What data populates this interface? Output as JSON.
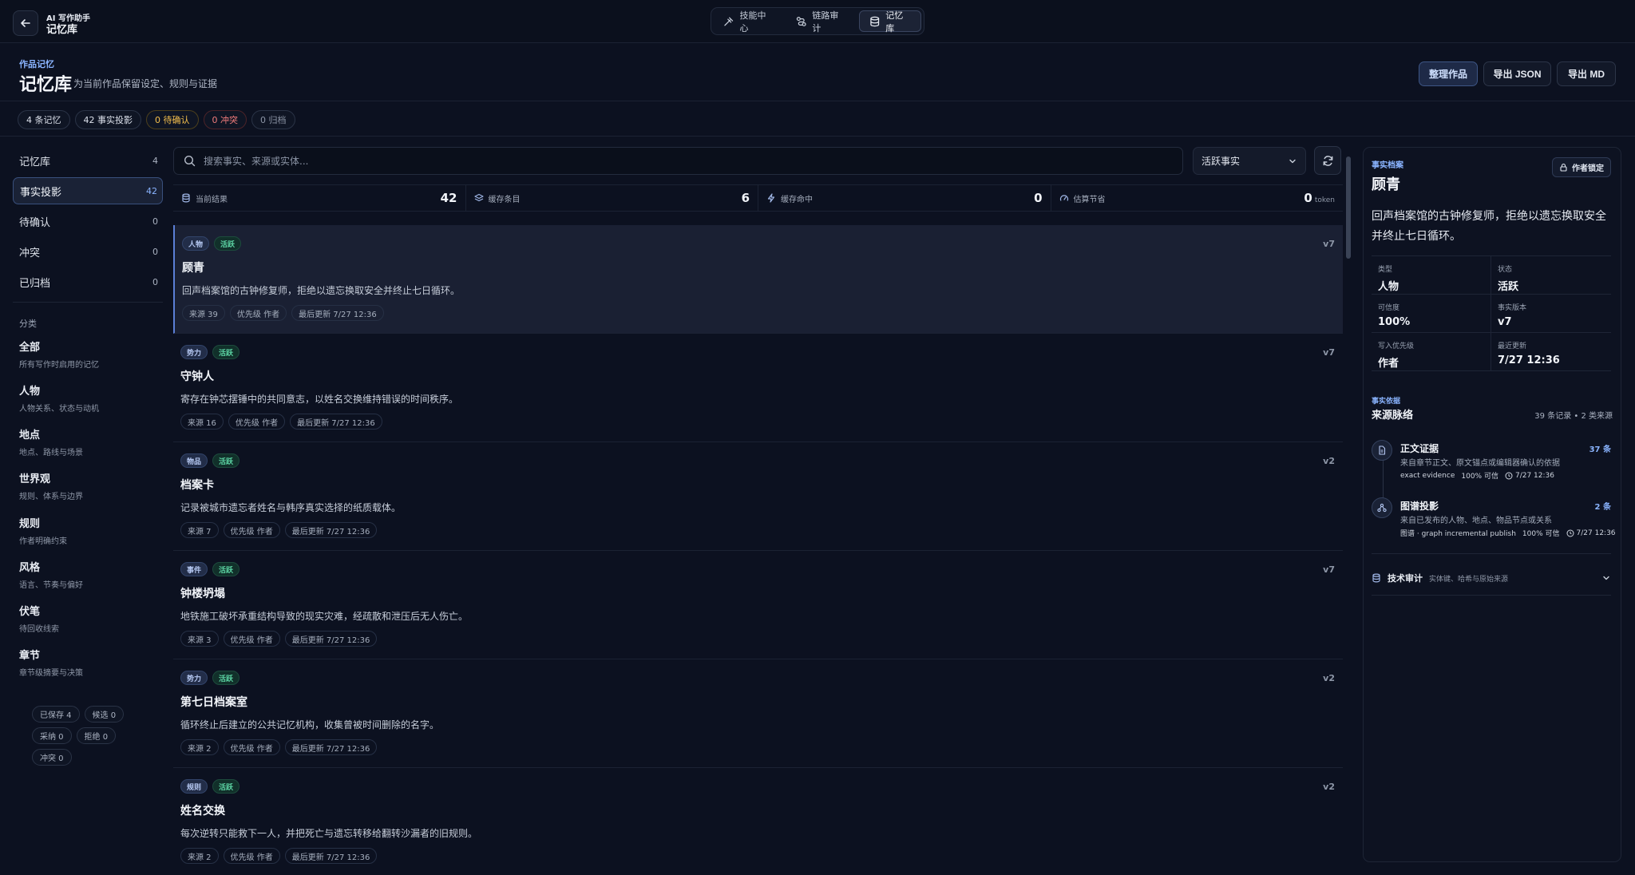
{
  "topbar": {
    "brand_sub": "AI 写作助手",
    "brand_title": "记忆库",
    "nav": [
      {
        "label": "技能中心",
        "icon": "skill-icon"
      },
      {
        "label": "链路审计",
        "icon": "route-icon"
      },
      {
        "label": "记忆库",
        "icon": "database-icon",
        "active": true
      }
    ]
  },
  "header": {
    "kicker": "作品记忆",
    "title": "记忆库",
    "subtitle": "为当前作品保留设定、规则与证据",
    "buttons": {
      "organize": "整理作品",
      "export_json": "导出 JSON",
      "export_md": "导出 MD"
    }
  },
  "summary_chips": {
    "memories": "4 条记忆",
    "projections": "42 事实投影",
    "pending": "0 待确认",
    "conflicts": "0 冲突",
    "archived": "0 归档"
  },
  "sidebar": {
    "items": [
      {
        "label": "记忆库",
        "count": "4"
      },
      {
        "label": "事实投影",
        "count": "42",
        "active": true
      },
      {
        "label": "待确认",
        "count": "0"
      },
      {
        "label": "冲突",
        "count": "0"
      },
      {
        "label": "已归档",
        "count": "0"
      }
    ],
    "category_heading": "分类",
    "categories": [
      {
        "name": "全部",
        "desc": "所有写作时启用的记忆"
      },
      {
        "name": "人物",
        "desc": "人物关系、状态与动机"
      },
      {
        "name": "地点",
        "desc": "地点、路线与场景"
      },
      {
        "name": "世界观",
        "desc": "规则、体系与边界"
      },
      {
        "name": "规则",
        "desc": "作者明确约束"
      },
      {
        "name": "风格",
        "desc": "语言、节奏与偏好"
      },
      {
        "name": "伏笔",
        "desc": "待回收线索"
      },
      {
        "name": "章节",
        "desc": "章节级摘要与决策"
      }
    ],
    "status_chips": [
      "已保存 4",
      "候选 0",
      "采纳 0",
      "拒绝 0",
      "冲突 0"
    ]
  },
  "search": {
    "placeholder": "搜索事实、来源或实体...",
    "filter_value": "活跃事实"
  },
  "stats": [
    {
      "label": "当前结果",
      "value": "42",
      "icon": "database-icon"
    },
    {
      "label": "缓存条目",
      "value": "6",
      "icon": "layers-icon"
    },
    {
      "label": "缓存命中",
      "value": "0",
      "icon": "bolt-icon"
    },
    {
      "label": "估算节省",
      "value": "0",
      "unit": "token",
      "icon": "gauge-icon"
    }
  ],
  "facts": [
    {
      "type": "人物",
      "status": "活跃",
      "version": "v7",
      "title": "顾青",
      "desc": "回声档案馆的古钟修复师，拒绝以遗忘换取安全并终止七日循环。",
      "source": "来源 39",
      "priority": "优先级 作者",
      "updated": "最后更新 7/27 12:36",
      "active": true
    },
    {
      "type": "势力",
      "status": "活跃",
      "version": "v7",
      "title": "守钟人",
      "desc": "寄存在钟芯摆锤中的共同意志，以姓名交换维持错误的时间秩序。",
      "source": "来源 16",
      "priority": "优先级 作者",
      "updated": "最后更新 7/27 12:36"
    },
    {
      "type": "物品",
      "status": "活跃",
      "version": "v2",
      "title": "档案卡",
      "desc": "记录被城市遗忘者姓名与韩序真实选择的纸质载体。",
      "source": "来源 7",
      "priority": "优先级 作者",
      "updated": "最后更新 7/27 12:36"
    },
    {
      "type": "事件",
      "status": "活跃",
      "version": "v7",
      "title": "钟楼坍塌",
      "desc": "地铁施工破坏承重结构导致的现实灾难，经疏散和泄压后无人伤亡。",
      "source": "来源 3",
      "priority": "优先级 作者",
      "updated": "最后更新 7/27 12:36"
    },
    {
      "type": "势力",
      "status": "活跃",
      "version": "v2",
      "title": "第七日档案室",
      "desc": "循环终止后建立的公共记忆机构，收集曾被时间删除的名字。",
      "source": "来源 2",
      "priority": "优先级 作者",
      "updated": "最后更新 7/27 12:36"
    },
    {
      "type": "规则",
      "status": "活跃",
      "version": "v2",
      "title": "姓名交换",
      "desc": "每次逆转只能救下一人，并把死亡与遗忘转移给翻转沙漏者的旧规则。",
      "source": "来源 2",
      "priority": "优先级 作者",
      "updated": "最后更新 7/27 12:36"
    }
  ],
  "detail": {
    "kicker": "事实档案",
    "title": "顾青",
    "lock_label": "作者锁定",
    "desc": "回声档案馆的古钟修复师，拒绝以遗忘换取安全并终止七日循环。",
    "grid": [
      {
        "label": "类型",
        "value": "人物"
      },
      {
        "label": "状态",
        "value": "活跃"
      },
      {
        "label": "可信度",
        "value": "100%"
      },
      {
        "label": "事实版本",
        "value": "v7"
      },
      {
        "label": "写入优先级",
        "value": "作者"
      },
      {
        "label": "最近更新",
        "value": "7/27 12:36"
      }
    ],
    "sources_kicker": "事实依据",
    "sources_title": "来源脉络",
    "sources_count": "39 条记录 • 2 类来源",
    "sources": [
      {
        "name": "正文证据",
        "count": "37 条",
        "desc": "来自章节正文、原文锚点或编辑器确认的依据",
        "foot1": "exact evidence",
        "foot2": "100% 可信",
        "time": "7/27 12:36",
        "icon": "document-icon"
      },
      {
        "name": "图谱投影",
        "count": "2 条",
        "desc": "来自已发布的人物、地点、物品节点或关系",
        "foot1": "图谱 · graph incremental publish",
        "foot2": "100% 可信",
        "time": "7/27 12:36",
        "icon": "graph-icon"
      }
    ],
    "audit_title": "技术审计",
    "audit_desc": "实体键、哈希与原始来源"
  }
}
